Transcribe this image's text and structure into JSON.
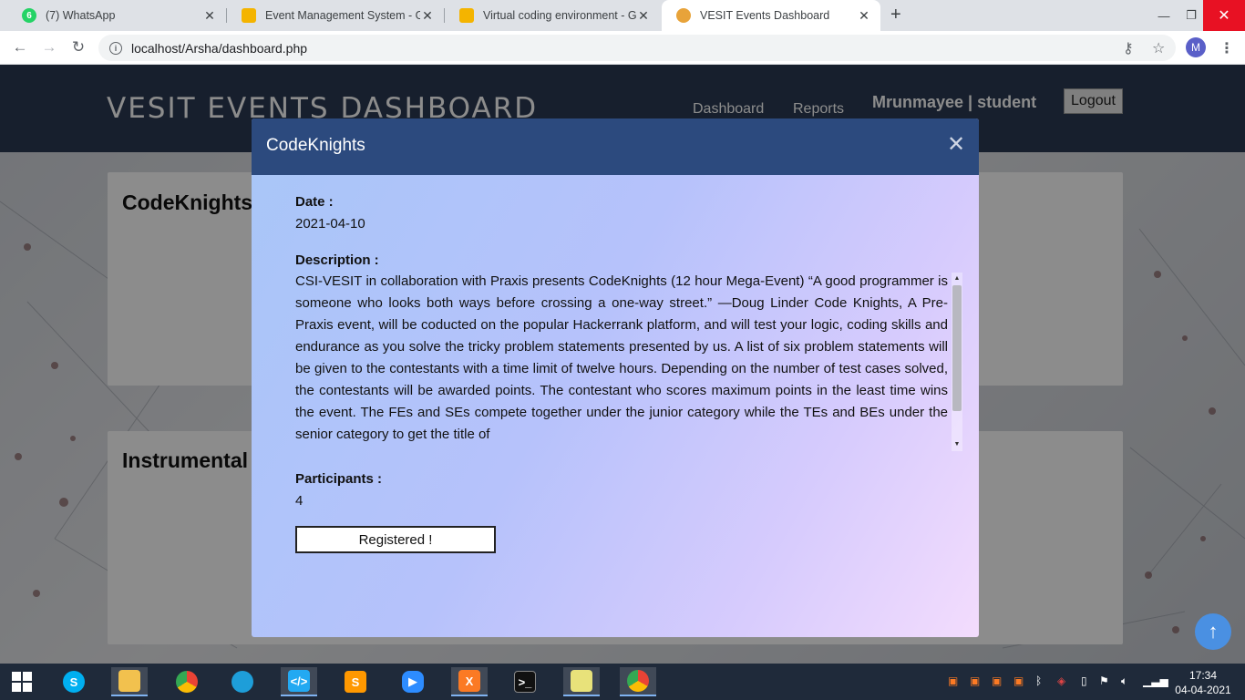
{
  "browser": {
    "tabs": [
      {
        "title": "(7) WhatsApp",
        "badge": "6",
        "color": "#25d366"
      },
      {
        "title": "Event Management System - Go",
        "color": "#f4b400"
      },
      {
        "title": "Virtual coding environment - Go",
        "color": "#f4b400"
      },
      {
        "title": "VESIT Events Dashboard",
        "color": "#e8a33a"
      }
    ],
    "url": "localhost/Arsha/dashboard.php",
    "profile_initial": "M"
  },
  "site": {
    "brand": "VESIT EVENTS DASHBOARD",
    "nav": {
      "dashboard": "Dashboard",
      "reports": "Reports"
    },
    "user": "Mrunmayee | student",
    "logout": "Logout",
    "cards": [
      {
        "title": "CodeKnights"
      },
      {
        "title": "Instrumental"
      }
    ]
  },
  "modal": {
    "title": "CodeKnights",
    "date_label": "Date :",
    "date": "2021-04-10",
    "description_label": "Description :",
    "description": "CSI-VESIT in collaboration with Praxis presents CodeKnights (12 hour Mega-Event) “A good programmer is someone who looks both ways before crossing a one-way street.” —Doug Linder Code Knights, A Pre-Praxis event, will be coducted on the popular Hackerrank platform, and will test your logic, coding skills and endurance as you solve the tricky problem statements presented by us. A list of six problem statements will be given to the contestants with a time limit of twelve hours. Depending on the number of test cases solved, the contestants will be awarded points. The contestant who scores maximum points in the least time wins the event. The FEs and SEs compete together under the junior category while the TEs and BEs under the senior category to get the title of",
    "participants_label": "Participants :",
    "participants": "4",
    "registered_button": "Registered !"
  },
  "taskbar": {
    "time": "17:34",
    "date": "04-04-2021"
  }
}
